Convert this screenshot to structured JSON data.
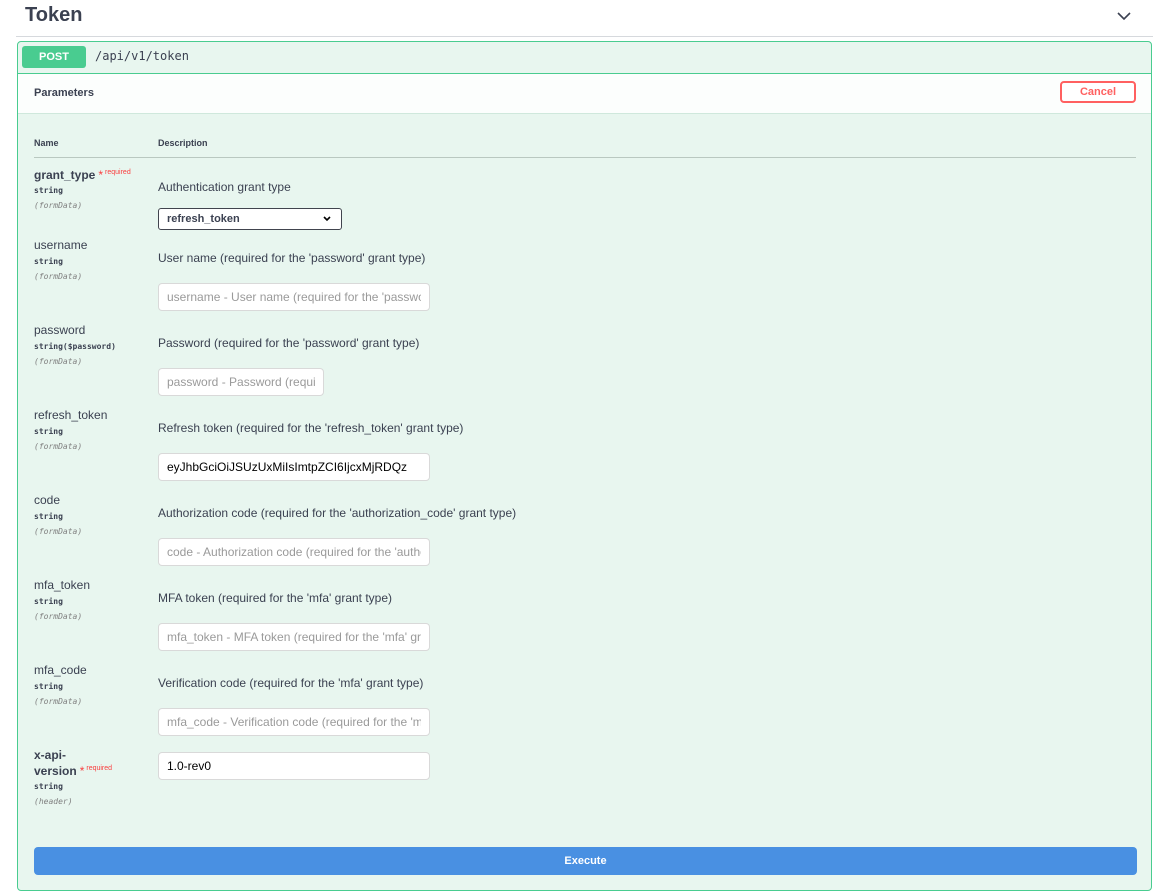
{
  "tag": {
    "title": "Token",
    "chevron_icon": "chevron-down-icon"
  },
  "operation": {
    "method": "POST",
    "path": "/api/v1/token"
  },
  "section": {
    "title": "Parameters",
    "cancel_label": "Cancel"
  },
  "columns": {
    "name": "Name",
    "description": "Description"
  },
  "required_label": "required",
  "required_star": "*",
  "params": [
    {
      "name": "grant_type",
      "required": true,
      "type": "string",
      "in": "(formData)",
      "description": "Authentication grant type",
      "control": "select",
      "value": "refresh_token",
      "placeholder": ""
    },
    {
      "name": "username",
      "required": false,
      "type": "string",
      "in": "(formData)",
      "description": "User name (required for the 'password' grant type)",
      "control": "input",
      "value": "",
      "placeholder": "username - User name (required for the 'password' grant type)"
    },
    {
      "name": "password",
      "required": false,
      "type": "string($password)",
      "in": "(formData)",
      "description": "Password (required for the 'password' grant type)",
      "control": "input",
      "value": "",
      "placeholder": "password - Password (required for the 'password' grant type)"
    },
    {
      "name": "refresh_token",
      "required": false,
      "type": "string",
      "in": "(formData)",
      "description": "Refresh token (required for the 'refresh_token' grant type)",
      "control": "input",
      "value": "eyJhbGciOiJSUzUxMiIsImtpZCI6IjcxMjRDQz",
      "placeholder": ""
    },
    {
      "name": "code",
      "required": false,
      "type": "string",
      "in": "(formData)",
      "description": "Authorization code (required for the 'authorization_code' grant type)",
      "control": "input",
      "value": "",
      "placeholder": "code - Authorization code (required for the 'authorization_code' grant type)"
    },
    {
      "name": "mfa_token",
      "required": false,
      "type": "string",
      "in": "(formData)",
      "description": "MFA token (required for the 'mfa' grant type)",
      "control": "input",
      "value": "",
      "placeholder": "mfa_token - MFA token (required for the 'mfa' grant type)"
    },
    {
      "name": "mfa_code",
      "required": false,
      "type": "string",
      "in": "(formData)",
      "description": "Verification code (required for the 'mfa' grant type)",
      "control": "input",
      "value": "",
      "placeholder": "mfa_code - Verification code (required for the 'mfa' grant type)"
    },
    {
      "name": "x-api-version",
      "name_line1": "x-api-",
      "name_line2": "version",
      "required": true,
      "type": "string",
      "in": "(header)",
      "description": "",
      "control": "input",
      "value": "1.0-rev0",
      "placeholder": ""
    }
  ],
  "execute_label": "Execute",
  "colors": {
    "post": "#49cc90",
    "cancel": "#ff6060",
    "execute": "#4990e2",
    "block_bg": "#e8f6ef",
    "required": "#f93e3e"
  }
}
